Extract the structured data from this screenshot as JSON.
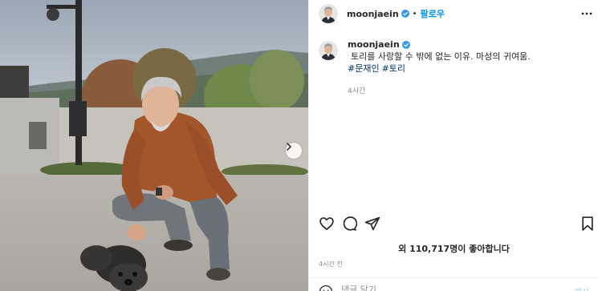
{
  "photo": {
    "alt": "",
    "next_icon": "chevron-right-icon"
  },
  "header": {
    "username": "moonjaein",
    "separator": "•",
    "follow_label": "팔로우",
    "more_icon": "ellipsis-icon"
  },
  "caption": {
    "username": "moonjaein",
    "text": "토리를 사랑할 수 밖에 없는 이유. 마성의 귀여움.",
    "tags": [
      "#문재인",
      "#토리"
    ],
    "time": "4시간"
  },
  "actions": {
    "like_icon": "heart-icon",
    "comment_icon": "comment-icon",
    "share_icon": "send-icon",
    "save_icon": "bookmark-icon"
  },
  "likes": {
    "text": "외 110,717명이 좋아합니다"
  },
  "post_time": "4시간 전",
  "comment_box": {
    "placeholder": "댓글 달기...",
    "post_label": "게시"
  },
  "colors": {
    "accent": "#0095f6",
    "verified": "#3897f0",
    "hashtag": "#00376b",
    "muted": "#8e8e8e"
  }
}
